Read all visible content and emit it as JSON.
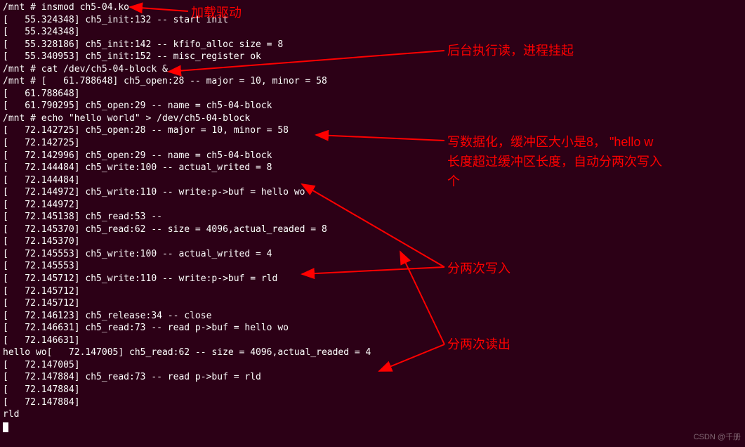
{
  "terminal": {
    "lines": [
      "/mnt # insmod ch5-04.ko",
      "[   55.324348] ch5_init:132 -- start init",
      "[   55.324348]",
      "[   55.328186] ch5_init:142 -- kfifo_alloc size = 8",
      "[   55.340953] ch5_init:152 -- misc_register ok",
      "/mnt # cat /dev/ch5-04-block &",
      "/mnt # [   61.788648] ch5_open:28 -- major = 10, minor = 58",
      "[   61.788648]",
      "[   61.790295] ch5_open:29 -- name = ch5-04-block",
      "",
      "/mnt # echo \"hello world\" > /dev/ch5-04-block",
      "[   72.142725] ch5_open:28 -- major = 10, minor = 58",
      "[   72.142725]",
      "[   72.142996] ch5_open:29 -- name = ch5-04-block",
      "[   72.144484] ch5_write:100 -- actual_writed = 8",
      "[   72.144484]",
      "[   72.144972] ch5_write:110 -- write:p->buf = hello wo",
      "[   72.144972]",
      "[   72.145138] ch5_read:53 --",
      "[   72.145370] ch5_read:62 -- size = 4096,actual_readed = 8",
      "[   72.145370]",
      "[   72.145553] ch5_write:100 -- actual_writed = 4",
      "[   72.145553]",
      "[   72.145712] ch5_write:110 -- write:p->buf = rld",
      "[   72.145712]",
      "[   72.145712]",
      "[   72.146123] ch5_release:34 -- close",
      "[   72.146631] ch5_read:73 -- read p->buf = hello wo",
      "[   72.146631]",
      "hello wo[   72.147005] ch5_read:62 -- size = 4096,actual_readed = 4",
      "[   72.147005]",
      "[   72.147884] ch5_read:73 -- read p->buf = rld",
      "[   72.147884]",
      "[   72.147884]",
      "rld"
    ]
  },
  "annotations": {
    "a1": "加载驱动",
    "a2": "后台执行读，进程挂起",
    "a3_line1": "写数据化，缓冲区大小是8，  \"hello w",
    "a3_line2": "长度超过缓冲区长度，自动分两次写入",
    "a3_line3": "个",
    "a4": "分两次写入",
    "a5": "分两次读出"
  },
  "watermark": "CSDN @千册"
}
